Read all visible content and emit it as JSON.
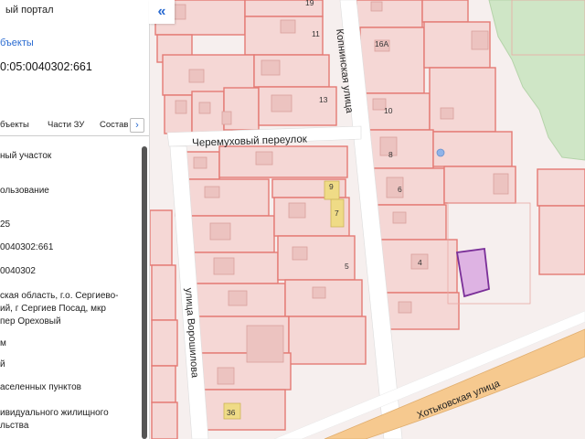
{
  "panel": {
    "title": "ый портал",
    "link": "бъекты",
    "cadastral_number": "0:05:0040302:661",
    "tabs": [
      "бъекты",
      "Части ЗУ",
      "Состав"
    ],
    "next_tab": "›",
    "rows": [
      "ный участок",
      "ользование",
      "25",
      "0040302:661",
      "0040302",
      "ская область, г.о. Сергиево-",
      "ий, г Сергиев Посад, мкр",
      "пер Ореховый",
      "м",
      "й",
      "аселенных пунктов",
      "ивидуального жилищного",
      "льства"
    ]
  },
  "map": {
    "collapse_label": "«",
    "streets": {
      "cheremukhovy": "Черемуховый переулок",
      "kopninskaya": "Копнинская улица",
      "voroshilova": "улица Ворошилова",
      "khotkovskaya": "Хотьковская улица"
    },
    "house_numbers": {
      "n19": "19",
      "n11": "11",
      "n13": "13",
      "n16a": "16А",
      "n10": "10",
      "n8": "8",
      "n6": "6",
      "n9": "9",
      "n7": "7",
      "n5": "5",
      "n4": "4",
      "n36": "36"
    },
    "colors": {
      "background": "#f6efee",
      "parcel_fill": "#f5d7d5",
      "parcel_border": "#e47a74",
      "road": "#ffffff",
      "main_road": "#f6c98f",
      "forest": "#cfe6c6",
      "selected_fill": "#d9a8e0",
      "selected_border": "#7a2f98",
      "highlight_building": "#efdb86"
    }
  }
}
